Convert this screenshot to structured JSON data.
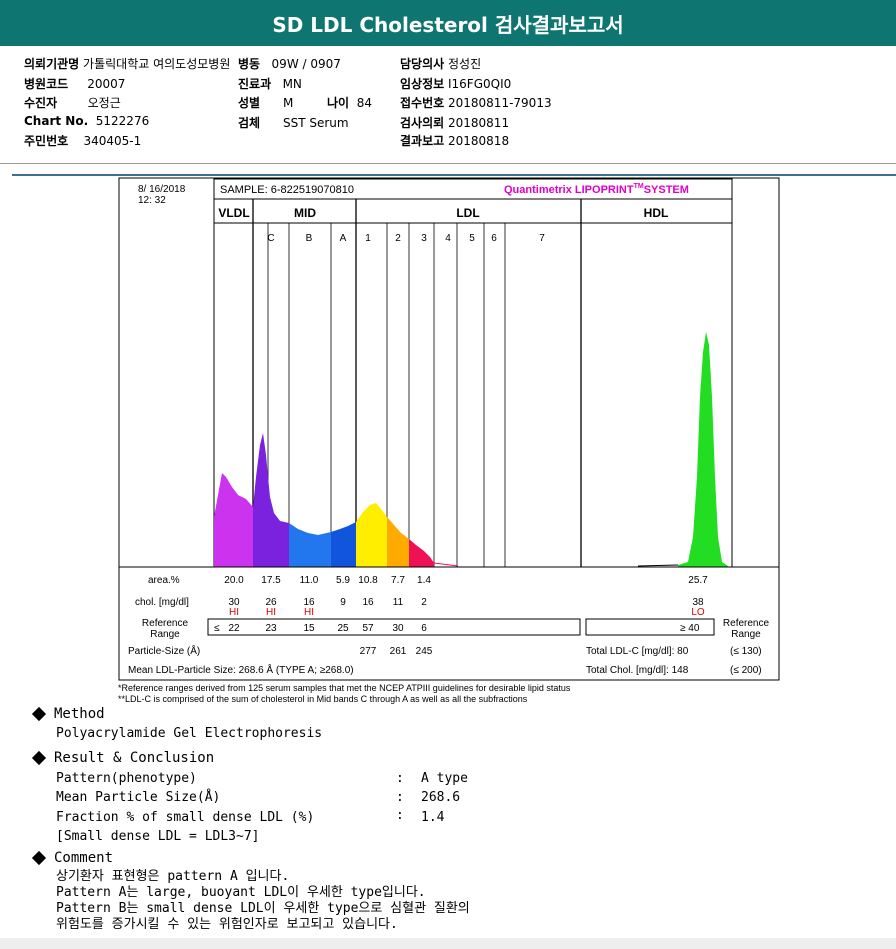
{
  "title": "SD LDL Cholesterol 검사결과보고서",
  "info": {
    "col1": [
      {
        "k": "의뢰기관명",
        "v": "가톨릭대학교 여의도성모병원"
      },
      {
        "k": "병원코드",
        "v": "20007"
      },
      {
        "k": "수진자",
        "v": "오정근"
      },
      {
        "k": "Chart No.",
        "v": "5122276"
      },
      {
        "k": "주민번호",
        "v": "340405-1"
      }
    ],
    "ward": {
      "k": "병동",
      "v": "09W / 0907"
    },
    "dept": {
      "k": "진료과",
      "v": "MN"
    },
    "sex": {
      "k": "성별",
      "v": "M"
    },
    "age": {
      "k": "나이",
      "v": "84"
    },
    "specimen": {
      "k": "검체",
      "v": "SST Serum"
    },
    "col3": [
      {
        "k": "담당의사",
        "v": "정성진"
      },
      {
        "k": "임상정보",
        "v": "I16FG0QI0"
      },
      {
        "k": "접수번호",
        "v": "20180811-79013"
      },
      {
        "k": "검사의뢰",
        "v": "20180811"
      },
      {
        "k": "결과보고",
        "v": "20180818"
      }
    ]
  },
  "chart": {
    "date": "8/ 16/2018",
    "time": "12: 32",
    "sample": "SAMPLE:   6-822519070810",
    "brand": "Quantimetrix LIPOPRINT",
    "brand_tm": "TM",
    "brand_sys": "SYSTEM",
    "groups": [
      "VLDL",
      "MID",
      "LDL",
      "HDL"
    ],
    "sub_labels": [
      "C",
      "B",
      "A",
      "1",
      "2",
      "3",
      "4",
      "5",
      "6",
      "7"
    ],
    "area_label": "area.%",
    "chol_label": "chol. [mg/dl]",
    "ref_label": [
      "Reference",
      "Range"
    ],
    "area_values": [
      "20.0",
      "17.5",
      "11.0",
      "5.9",
      "10.8",
      "7.7",
      "1.4"
    ],
    "hdl_area": "25.7",
    "chol_values": [
      "30",
      "26",
      "16",
      "9",
      "16",
      "11",
      "2"
    ],
    "hdl_chol": "38",
    "flags": [
      "HI",
      "HI",
      "HI"
    ],
    "hdl_flag": "LO",
    "ref_le": "≤",
    "ref_values": [
      "22",
      "23",
      "15",
      "25",
      "57",
      "30",
      "6"
    ],
    "hdl_ref": "≥ 40",
    "ref_right": [
      "Reference",
      "Range"
    ],
    "particle_label": "Particle-Size (Å)",
    "particle_values": [
      "277",
      "261",
      "245"
    ],
    "mean_label": "Mean LDL-Particle Size:   268.6 Å   (TYPE A; ≥268.0)",
    "total_ldl": "Total LDL-C [mg/dl]:  80",
    "total_ldl_ref": "(≤ 130)",
    "total_chol": "Total Chol. [mg/dl]:   148",
    "total_chol_ref": "(≤ 200)",
    "footnote1": "*Reference ranges derived from 125 serum samples that met the NCEP ATPIII guidelines for desirable lipid status",
    "footnote2": "**LDL-C is comprised of the sum of cholesterol in Mid bands C through A as well as all the subfractions"
  },
  "chart_data": {
    "type": "area",
    "title": "",
    "categories": [
      "VLDL",
      "MID C",
      "MID B",
      "MID A",
      "LDL 1",
      "LDL 2",
      "LDL 3",
      "LDL 4",
      "LDL 5",
      "LDL 6",
      "LDL 7",
      "HDL"
    ],
    "series": [
      {
        "name": "area.%",
        "values": [
          20.0,
          17.5,
          11.0,
          5.9,
          10.8,
          7.7,
          1.4,
          0,
          0,
          0,
          0,
          25.7
        ]
      },
      {
        "name": "chol. [mg/dl]",
        "values": [
          30,
          26,
          16,
          9,
          16,
          11,
          2,
          0,
          0,
          0,
          0,
          38
        ]
      }
    ],
    "reference": [
      22,
      23,
      15,
      25,
      57,
      30,
      6,
      null,
      null,
      null,
      null,
      40
    ],
    "colors": {
      "VLDL": "#cc33ee",
      "C": "#7a22dd",
      "B": "#2277ee",
      "A": "#1155dd",
      "L1": "#ffee00",
      "L2": "#ffaa00",
      "L3": "#ee1155",
      "HDL": "#22dd22"
    }
  },
  "sections": {
    "method_title": "Method",
    "method_text": "Polyacrylamide Gel Electrophoresis",
    "result_title": "Result & Conclusion",
    "result_rows": [
      {
        "k": "Pattern(phenotype)",
        "v": "A type"
      },
      {
        "k": "Mean Particle Size(Å)",
        "v": "268.6"
      },
      {
        "k": "Fraction % of small dense LDL (%)",
        "v": "1.4"
      }
    ],
    "result_note": "[Small dense LDL = LDL3~7]",
    "colon": ":",
    "comment_title": "Comment",
    "comment_lines": [
      "상기환자 표현형은 pattern A 입니다.",
      "Pattern A는 large, buoyant LDL이 우세한 type입니다.",
      "Pattern B는 small dense LDL이 우세한 type으로 심혈관 질환의",
      "위험도를 증가시킬 수 있는 위험인자로 보고되고 있습니다."
    ]
  }
}
